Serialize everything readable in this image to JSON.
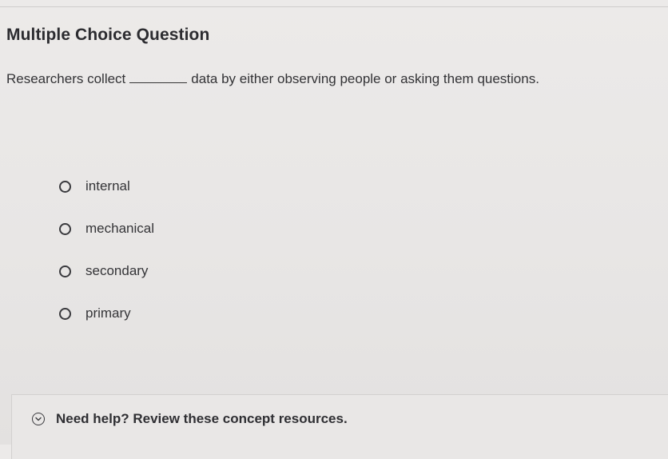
{
  "question": {
    "type_heading": "Multiple Choice Question",
    "prompt_before": "Researchers collect",
    "prompt_after": "data by either observing people or asking them questions."
  },
  "options": [
    {
      "label": "internal",
      "selected": false
    },
    {
      "label": "mechanical",
      "selected": false
    },
    {
      "label": "secondary",
      "selected": false
    },
    {
      "label": "primary",
      "selected": false
    }
  ],
  "help": {
    "label": "Need help? Review these concept resources.",
    "icon": "chevron-down-icon"
  }
}
